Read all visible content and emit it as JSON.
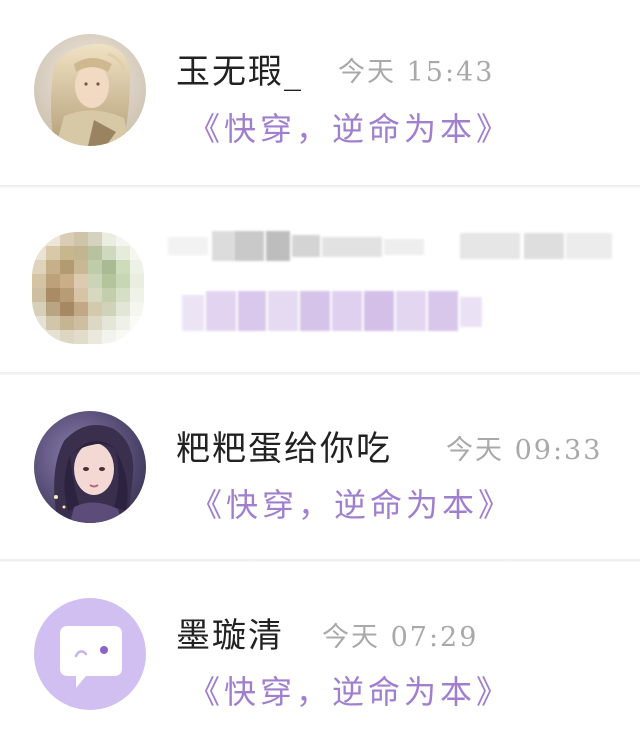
{
  "conversations": [
    {
      "name": "玉无瑕_",
      "time": "今天 15:43",
      "message": "《快穿，逆命为本》",
      "avatar": "portrait-avatar-blonde-figure"
    },
    {
      "name": "",
      "time": "",
      "message": "",
      "avatar": "pixelated-avatar",
      "obscured": true
    },
    {
      "name": "粑粑蛋给你吃",
      "time": "今天 09:33",
      "message": "《快穿，逆命为本》",
      "avatar": "portrait-avatar-dark-haired-girl"
    },
    {
      "name": "墨璇清",
      "time": "今天 07:29",
      "message": "《快穿，逆命为本》",
      "avatar": "chat-bubble-icon"
    }
  ],
  "colors": {
    "name": "#222222",
    "time": "#a9a9a9",
    "message": "#a07fcf",
    "default_avatar_bg": "#d2bff1",
    "separator": "#ececec"
  }
}
